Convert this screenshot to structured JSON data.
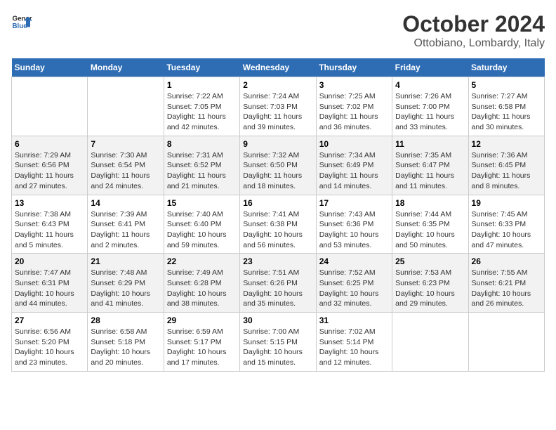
{
  "header": {
    "logo_line1": "General",
    "logo_line2": "Blue",
    "title": "October 2024",
    "subtitle": "Ottobiano, Lombardy, Italy"
  },
  "calendar": {
    "days_of_week": [
      "Sunday",
      "Monday",
      "Tuesday",
      "Wednesday",
      "Thursday",
      "Friday",
      "Saturday"
    ],
    "weeks": [
      [
        {
          "day": "",
          "sunrise": "",
          "sunset": "",
          "daylight": ""
        },
        {
          "day": "",
          "sunrise": "",
          "sunset": "",
          "daylight": ""
        },
        {
          "day": "1",
          "sunrise": "Sunrise: 7:22 AM",
          "sunset": "Sunset: 7:05 PM",
          "daylight": "Daylight: 11 hours and 42 minutes."
        },
        {
          "day": "2",
          "sunrise": "Sunrise: 7:24 AM",
          "sunset": "Sunset: 7:03 PM",
          "daylight": "Daylight: 11 hours and 39 minutes."
        },
        {
          "day": "3",
          "sunrise": "Sunrise: 7:25 AM",
          "sunset": "Sunset: 7:02 PM",
          "daylight": "Daylight: 11 hours and 36 minutes."
        },
        {
          "day": "4",
          "sunrise": "Sunrise: 7:26 AM",
          "sunset": "Sunset: 7:00 PM",
          "daylight": "Daylight: 11 hours and 33 minutes."
        },
        {
          "day": "5",
          "sunrise": "Sunrise: 7:27 AM",
          "sunset": "Sunset: 6:58 PM",
          "daylight": "Daylight: 11 hours and 30 minutes."
        }
      ],
      [
        {
          "day": "6",
          "sunrise": "Sunrise: 7:29 AM",
          "sunset": "Sunset: 6:56 PM",
          "daylight": "Daylight: 11 hours and 27 minutes."
        },
        {
          "day": "7",
          "sunrise": "Sunrise: 7:30 AM",
          "sunset": "Sunset: 6:54 PM",
          "daylight": "Daylight: 11 hours and 24 minutes."
        },
        {
          "day": "8",
          "sunrise": "Sunrise: 7:31 AM",
          "sunset": "Sunset: 6:52 PM",
          "daylight": "Daylight: 11 hours and 21 minutes."
        },
        {
          "day": "9",
          "sunrise": "Sunrise: 7:32 AM",
          "sunset": "Sunset: 6:50 PM",
          "daylight": "Daylight: 11 hours and 18 minutes."
        },
        {
          "day": "10",
          "sunrise": "Sunrise: 7:34 AM",
          "sunset": "Sunset: 6:49 PM",
          "daylight": "Daylight: 11 hours and 14 minutes."
        },
        {
          "day": "11",
          "sunrise": "Sunrise: 7:35 AM",
          "sunset": "Sunset: 6:47 PM",
          "daylight": "Daylight: 11 hours and 11 minutes."
        },
        {
          "day": "12",
          "sunrise": "Sunrise: 7:36 AM",
          "sunset": "Sunset: 6:45 PM",
          "daylight": "Daylight: 11 hours and 8 minutes."
        }
      ],
      [
        {
          "day": "13",
          "sunrise": "Sunrise: 7:38 AM",
          "sunset": "Sunset: 6:43 PM",
          "daylight": "Daylight: 11 hours and 5 minutes."
        },
        {
          "day": "14",
          "sunrise": "Sunrise: 7:39 AM",
          "sunset": "Sunset: 6:41 PM",
          "daylight": "Daylight: 11 hours and 2 minutes."
        },
        {
          "day": "15",
          "sunrise": "Sunrise: 7:40 AM",
          "sunset": "Sunset: 6:40 PM",
          "daylight": "Daylight: 10 hours and 59 minutes."
        },
        {
          "day": "16",
          "sunrise": "Sunrise: 7:41 AM",
          "sunset": "Sunset: 6:38 PM",
          "daylight": "Daylight: 10 hours and 56 minutes."
        },
        {
          "day": "17",
          "sunrise": "Sunrise: 7:43 AM",
          "sunset": "Sunset: 6:36 PM",
          "daylight": "Daylight: 10 hours and 53 minutes."
        },
        {
          "day": "18",
          "sunrise": "Sunrise: 7:44 AM",
          "sunset": "Sunset: 6:35 PM",
          "daylight": "Daylight: 10 hours and 50 minutes."
        },
        {
          "day": "19",
          "sunrise": "Sunrise: 7:45 AM",
          "sunset": "Sunset: 6:33 PM",
          "daylight": "Daylight: 10 hours and 47 minutes."
        }
      ],
      [
        {
          "day": "20",
          "sunrise": "Sunrise: 7:47 AM",
          "sunset": "Sunset: 6:31 PM",
          "daylight": "Daylight: 10 hours and 44 minutes."
        },
        {
          "day": "21",
          "sunrise": "Sunrise: 7:48 AM",
          "sunset": "Sunset: 6:29 PM",
          "daylight": "Daylight: 10 hours and 41 minutes."
        },
        {
          "day": "22",
          "sunrise": "Sunrise: 7:49 AM",
          "sunset": "Sunset: 6:28 PM",
          "daylight": "Daylight: 10 hours and 38 minutes."
        },
        {
          "day": "23",
          "sunrise": "Sunrise: 7:51 AM",
          "sunset": "Sunset: 6:26 PM",
          "daylight": "Daylight: 10 hours and 35 minutes."
        },
        {
          "day": "24",
          "sunrise": "Sunrise: 7:52 AM",
          "sunset": "Sunset: 6:25 PM",
          "daylight": "Daylight: 10 hours and 32 minutes."
        },
        {
          "day": "25",
          "sunrise": "Sunrise: 7:53 AM",
          "sunset": "Sunset: 6:23 PM",
          "daylight": "Daylight: 10 hours and 29 minutes."
        },
        {
          "day": "26",
          "sunrise": "Sunrise: 7:55 AM",
          "sunset": "Sunset: 6:21 PM",
          "daylight": "Daylight: 10 hours and 26 minutes."
        }
      ],
      [
        {
          "day": "27",
          "sunrise": "Sunrise: 6:56 AM",
          "sunset": "Sunset: 5:20 PM",
          "daylight": "Daylight: 10 hours and 23 minutes."
        },
        {
          "day": "28",
          "sunrise": "Sunrise: 6:58 AM",
          "sunset": "Sunset: 5:18 PM",
          "daylight": "Daylight: 10 hours and 20 minutes."
        },
        {
          "day": "29",
          "sunrise": "Sunrise: 6:59 AM",
          "sunset": "Sunset: 5:17 PM",
          "daylight": "Daylight: 10 hours and 17 minutes."
        },
        {
          "day": "30",
          "sunrise": "Sunrise: 7:00 AM",
          "sunset": "Sunset: 5:15 PM",
          "daylight": "Daylight: 10 hours and 15 minutes."
        },
        {
          "day": "31",
          "sunrise": "Sunrise: 7:02 AM",
          "sunset": "Sunset: 5:14 PM",
          "daylight": "Daylight: 10 hours and 12 minutes."
        },
        {
          "day": "",
          "sunrise": "",
          "sunset": "",
          "daylight": ""
        },
        {
          "day": "",
          "sunrise": "",
          "sunset": "",
          "daylight": ""
        }
      ]
    ]
  }
}
